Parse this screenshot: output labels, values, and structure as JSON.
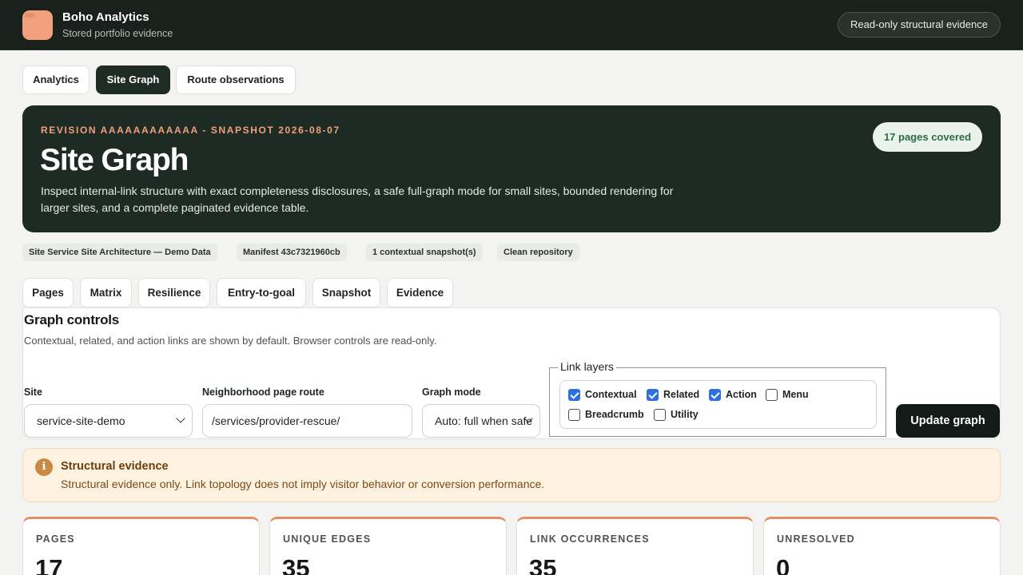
{
  "app": {
    "name": "Boho Analytics",
    "subtitle": "Stored portfolio evidence",
    "readonly_badge": "Read-only structural evidence"
  },
  "nav_tabs": [
    {
      "label": "Analytics",
      "active": false
    },
    {
      "label": "Site Graph",
      "active": true
    },
    {
      "label": "Route observations",
      "active": false
    }
  ],
  "hero": {
    "eyebrow": "REVISION AAAAAAAAAAAA - SNAPSHOT 2026-08-07",
    "title": "Site Graph",
    "description": "Inspect internal-link structure with exact completeness disclosures, a safe full-graph mode for small sites, bounded rendering for larger sites, and a complete paginated evidence table.",
    "pages_covered": "17 pages covered"
  },
  "meta_chips": [
    "Site Service Site Architecture — Demo Data",
    "Manifest 43c7321960cb",
    "1 contextual snapshot(s)",
    "Clean repository"
  ],
  "sub_tabs": [
    "Pages",
    "Matrix",
    "Resilience",
    "Entry-to-goal",
    "Snapshot",
    "Evidence"
  ],
  "controls": {
    "title": "Graph controls",
    "description": "Contextual, related, and action links are shown by default. Browser controls are read-only.",
    "site_label": "Site",
    "site_value": "service-site-demo",
    "route_label": "Neighborhood page route",
    "route_value": "/services/provider-rescue/",
    "mode_label": "Graph mode",
    "mode_value": "Auto: full when safe",
    "layers_legend": "Link layers",
    "layers": [
      {
        "label": "Contextual",
        "checked": true
      },
      {
        "label": "Related",
        "checked": true
      },
      {
        "label": "Action",
        "checked": true
      },
      {
        "label": "Menu",
        "checked": false
      },
      {
        "label": "Breadcrumb",
        "checked": false
      },
      {
        "label": "Utility",
        "checked": false
      }
    ],
    "update_button": "Update graph"
  },
  "notice": {
    "icon": "info-icon",
    "title": "Structural evidence",
    "text": "Structural evidence only. Link topology does not imply visitor behavior or conversion performance."
  },
  "stats": [
    {
      "label": "PAGES",
      "value": "17"
    },
    {
      "label": "UNIQUE EDGES",
      "value": "35"
    },
    {
      "label": "LINK OCCURRENCES",
      "value": "35"
    },
    {
      "label": "UNRESOLVED",
      "value": "0"
    }
  ],
  "colors": {
    "header_bg": "#1a211d",
    "hero_bg": "#1e2b25",
    "accent": "#f0a07c",
    "checkbox": "#2f6fe0",
    "notice_bg": "#fdf2df"
  }
}
